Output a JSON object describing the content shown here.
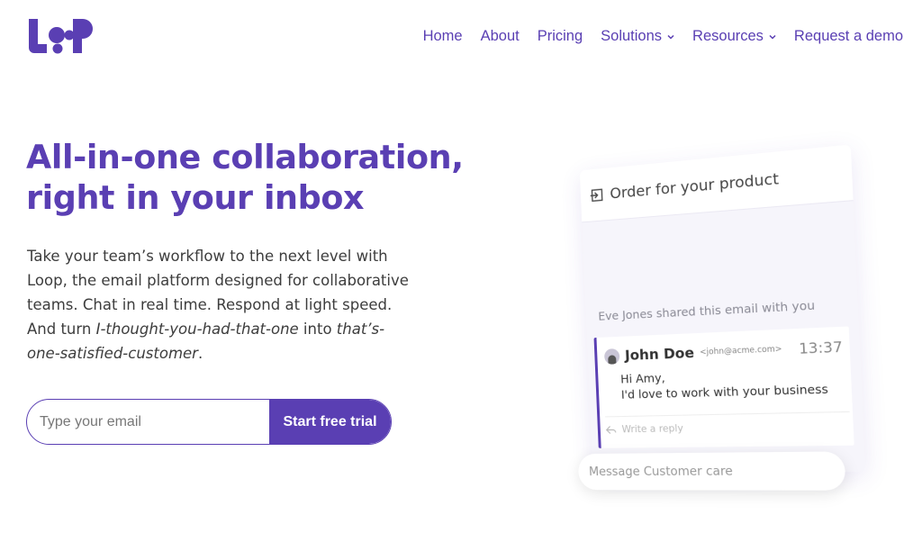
{
  "brand": {
    "name": "Loop",
    "color": "#5a3fb3"
  },
  "nav": {
    "items": [
      {
        "label": "Home",
        "dropdown": false
      },
      {
        "label": "About",
        "dropdown": false
      },
      {
        "label": "Pricing",
        "dropdown": false
      },
      {
        "label": "Solutions",
        "dropdown": true
      },
      {
        "label": "Resources",
        "dropdown": true
      },
      {
        "label": "Request a demo",
        "dropdown": false
      }
    ]
  },
  "hero": {
    "headline_line1": "All-in-one collaboration,",
    "headline_line2": "right in your inbox",
    "desc_part1": "Take your team’s workflow to the next level with Loop, the email platform designed for collaborative teams. Chat in real time. Respond at light speed. And turn ",
    "desc_em1": "I-thought-you-had-that-one",
    "desc_part2": " into ",
    "desc_em2": "that’s-one-satisfied-customer",
    "desc_part3": "."
  },
  "signup": {
    "email_placeholder": "Type your email",
    "email_value": "",
    "button_label": "Start free trial"
  },
  "mockup": {
    "title": "Order for your product",
    "title_icon": "share-in-icon",
    "shared_text": "Eve Jones shared this email with you",
    "message": {
      "sender": "John Doe",
      "sender_email": "<john@acme.com>",
      "time": "13:37",
      "line1": "Hi Amy,",
      "line2": "I'd love to work with your business"
    },
    "reply_placeholder": "Write a reply",
    "chat_placeholder": "Message Customer care"
  }
}
